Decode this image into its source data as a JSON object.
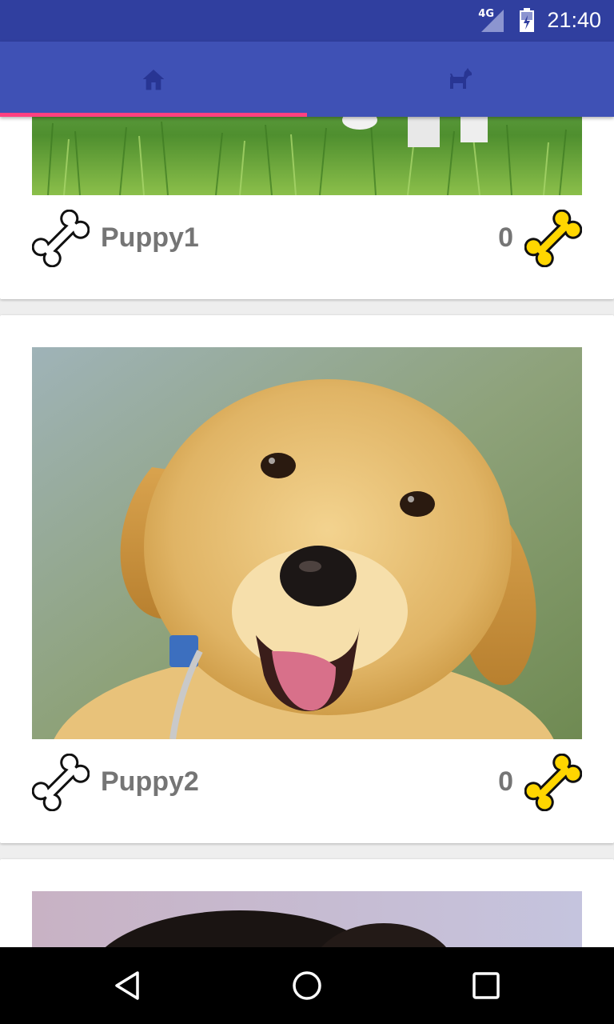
{
  "status_bar": {
    "network": "4G",
    "time": "21:40"
  },
  "tabs": [
    {
      "icon": "home-icon",
      "selected": true
    },
    {
      "icon": "dog-icon",
      "selected": false
    }
  ],
  "colors": {
    "primary": "#3f51b5",
    "primary_dark": "#303f9f",
    "accent": "#ff4081",
    "bone_filled": "#ffd600",
    "text_secondary": "#757575"
  },
  "feed": {
    "cards": [
      {
        "name": "Puppy1",
        "likes": "0",
        "image": "puppy-on-grass"
      },
      {
        "name": "Puppy2",
        "likes": "0",
        "image": "golden-retriever-puppy"
      },
      {
        "image": "black-puppy"
      }
    ]
  },
  "nav_bar": {
    "buttons": [
      "back",
      "home",
      "recents"
    ]
  }
}
